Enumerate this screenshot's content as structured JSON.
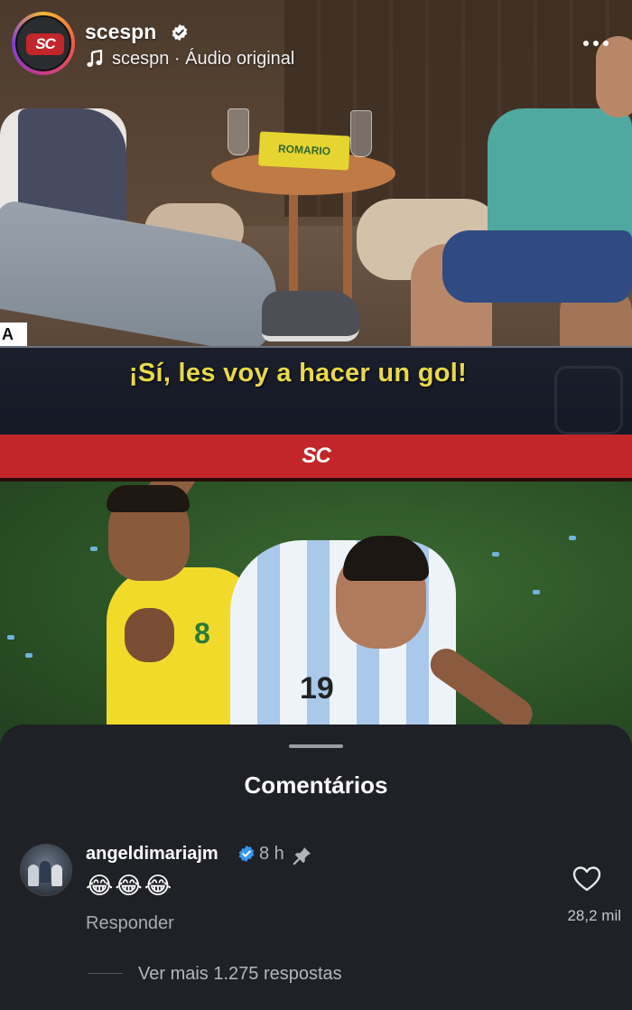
{
  "header": {
    "username": "scespn",
    "audio_label": "scespn · Áudio original",
    "avatar_logo_text": "SC"
  },
  "video": {
    "subtitle": "¡Sí, les voy a hacer un gol!",
    "brand_bar_logo": "SC",
    "jersey_text": "ROMARIO",
    "corner_tag": "A",
    "player_number": "19",
    "yellow_number": "8"
  },
  "comments_sheet": {
    "title": "Comentários",
    "comment": {
      "username": "angeldimariajm",
      "time": "8 h",
      "text": "😂😂😂",
      "reply_label": "Responder",
      "like_count": "28,2 mil"
    },
    "more_replies": "Ver mais 1.275 respostas"
  },
  "icons": [
    "verified-icon",
    "music-note-icon",
    "more-options-icon",
    "pin-icon",
    "heart-icon"
  ],
  "colors": {
    "brand_red": "#c2262a",
    "subtitle_yellow": "#e8d94a",
    "verified_blue": "#3897f0",
    "sheet_bg": "#1f2126"
  }
}
